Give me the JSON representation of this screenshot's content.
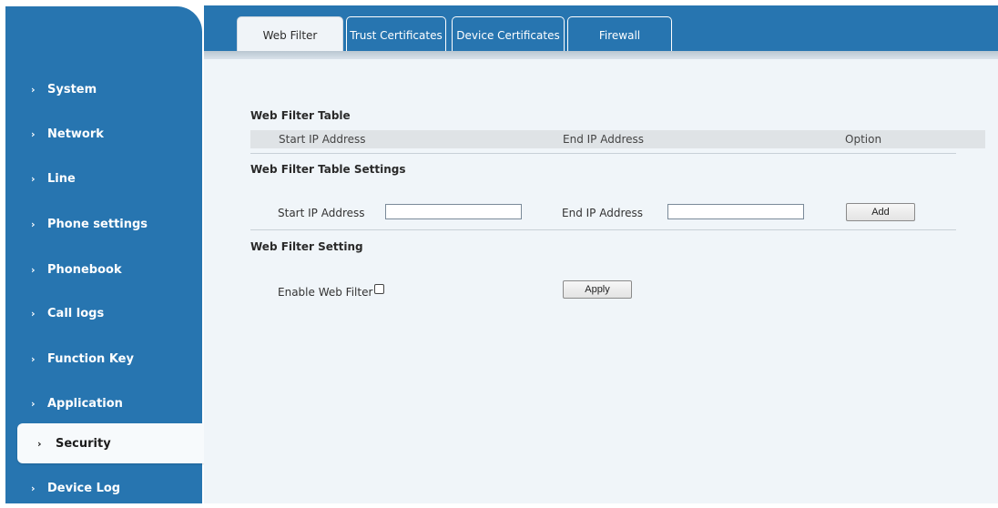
{
  "sidebar": {
    "items": [
      {
        "label": "System"
      },
      {
        "label": "Network"
      },
      {
        "label": "Line"
      },
      {
        "label": "Phone settings"
      },
      {
        "label": "Phonebook"
      },
      {
        "label": "Call logs"
      },
      {
        "label": "Function Key"
      },
      {
        "label": "Application"
      },
      {
        "label": "Security"
      },
      {
        "label": "Device Log"
      }
    ],
    "active": "Security",
    "chevron": "›"
  },
  "tabs": [
    {
      "label": "Web Filter"
    },
    {
      "label": "Trust Certificates"
    },
    {
      "label": "Device Certificates"
    },
    {
      "label": "Firewall"
    }
  ],
  "web_filter_table": {
    "title": "Web Filter Table",
    "columns": [
      "Start IP Address",
      "End IP Address",
      "Option"
    ]
  },
  "table_settings": {
    "title": "Web Filter Table Settings",
    "start_label": "Start IP Address",
    "start_value": "",
    "end_label": "End IP Address",
    "end_value": "",
    "add_label": "Add"
  },
  "filter_setting": {
    "title": "Web Filter Setting",
    "enable_label": "Enable Web Filter",
    "enabled": false,
    "apply_label": "Apply"
  },
  "colors": {
    "sidebar": "#2775b0",
    "main_bg": "#f0f5f9",
    "active_item": "#f7fafc"
  },
  "icons": [
    "chevron-right-icon",
    "checkbox-icon"
  ]
}
